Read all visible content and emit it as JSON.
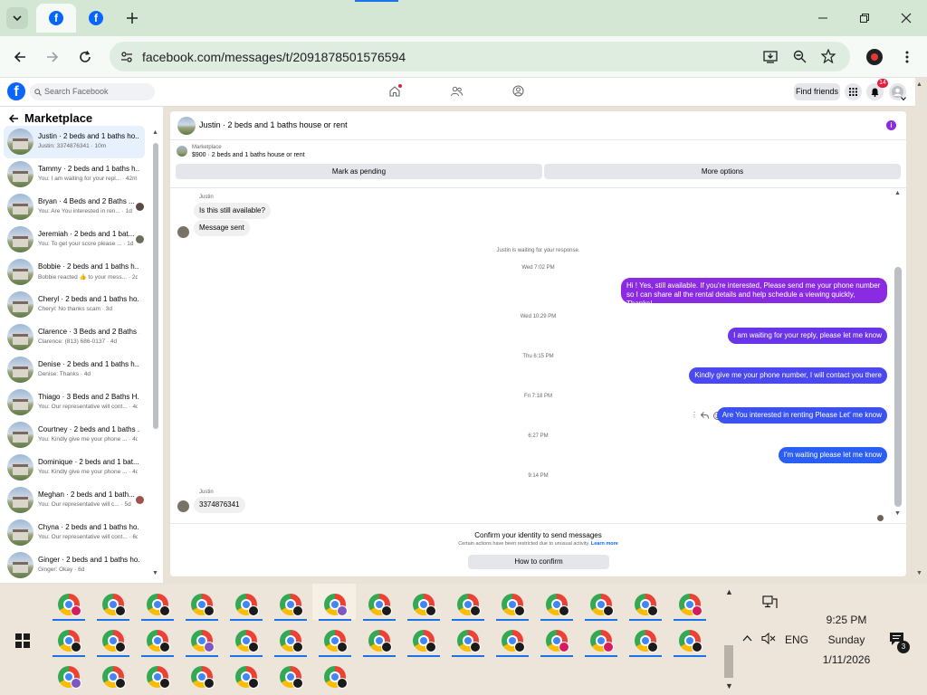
{
  "browser": {
    "url": "facebook.com/messages/t/2091878501576594"
  },
  "fb": {
    "logo": "f",
    "search_placeholder": "Search Facebook",
    "find_friends": "Find friends",
    "notif_count": "14"
  },
  "sidebar": {
    "title": "Marketplace",
    "conversations": [
      {
        "title": "Justin · 2 beds and 1 baths ho...",
        "sub": "Justin: 3374876341 · 10m",
        "active": true
      },
      {
        "title": "Tammy · 2 beds and 1 baths h...",
        "sub": "You: I am waiting for your repl... · 42m"
      },
      {
        "title": "Bryan · 4 Beds and 2 Baths ...",
        "sub": "You: Are You interested in ren... · 1d"
      },
      {
        "title": "Jeremiah · 2 beds and 1 bat...",
        "sub": "You: To get your score please ... · 1d"
      },
      {
        "title": "Bobbie · 2 beds and 1 baths h...",
        "sub": "Bobbie reacted 👍 to your mess... · 2d"
      },
      {
        "title": "Cheryl · 2 beds and 1 baths ho...",
        "sub": "Cheryl: No thanks scam · 3d"
      },
      {
        "title": "Clarence · 3 Beds and 2 Baths ...",
        "sub": "Clarence: (813) 686-0137 · 4d"
      },
      {
        "title": "Denise · 2 beds and 1 baths h...",
        "sub": "Denise: Thanks · 4d"
      },
      {
        "title": "Thiago · 3 Beds and 2 Baths H...",
        "sub": "You: Our representative will cont... · 4d"
      },
      {
        "title": "Courtney · 2 beds and 1 baths ...",
        "sub": "You: Kindly give me your phone ... · 4d"
      },
      {
        "title": "Dominique · 2 beds and 1 bat...",
        "sub": "You: Kindly give me your phone ... · 4d"
      },
      {
        "title": "Meghan · 2 beds and 1 bath...",
        "sub": "You: Our representative will c... · 5d"
      },
      {
        "title": "Chyna · 2 beds and 1 baths ho...",
        "sub": "You: Our representative will cont... · 6d"
      },
      {
        "title": "Ginger · 2 beds and 1 baths ho...",
        "sub": "Ginger: Okay · 6d"
      }
    ]
  },
  "chat": {
    "title": "Justin · 2 beds and 1 baths house or rent",
    "marketplace_label": "Marketplace",
    "listing": "$900 · 2 beds and 1 baths house or rent",
    "mark_pending": "Mark as pending",
    "more_options": "More options",
    "sender_name": "Justin",
    "msg_in_1": "Is this still available?",
    "msg_in_2": "Message sent",
    "waiting_note": "Justin is waiting for your response.",
    "time_1": "Wed 7:02 PM",
    "msg_out_1": "Hi ! Yes, still available. If you're interested, Please send me your phone number so I can share all the rental details and help schedule a viewing quickly, Thanks!",
    "time_2": "Wed 10:29 PM",
    "msg_out_2": "I am waiting for your reply, please let me know",
    "time_3": "Thu 6:15 PM",
    "msg_out_3": "Kindly give me your phone number, I will contact you there",
    "time_4": "Fri 7:18 PM",
    "msg_out_4": "Are You  interested in renting Please Let' me know",
    "time_5": "6:27 PM",
    "msg_out_5": "I'm waiting please let me know",
    "time_6": "9:14 PM",
    "sender_name_2": "Justin",
    "msg_in_3": "3374876341",
    "confirm_title": "Confirm your identity to send messages",
    "confirm_sub": "Certain actions have been restricted due to unusual activity.",
    "learn_more": "Learn more",
    "confirm_button": "How to confirm"
  },
  "taskbar": {
    "time": "9:25 PM",
    "day": "Sunday",
    "date": "1/11/2026",
    "lang": "ENG",
    "notif_count": "3"
  },
  "colors": {
    "fb_blue": "#0866ff",
    "msg_purple": "#8a2be2",
    "msg_blue": "#2b5ef2"
  }
}
